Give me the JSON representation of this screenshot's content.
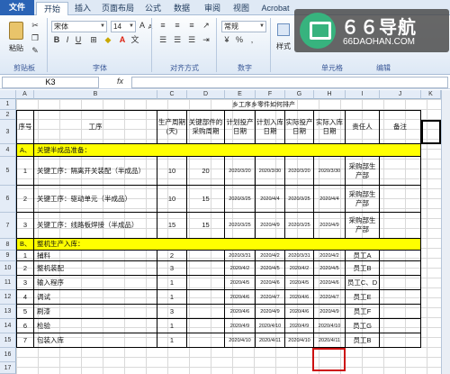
{
  "tabs": [
    "文件",
    "开始",
    "插入",
    "页面布局",
    "公式",
    "数据",
    "审阅",
    "视图",
    "Acrobat"
  ],
  "ribbon": {
    "paste_label": "粘贴",
    "font_name": "宋体",
    "font_size": "14",
    "number_format": "常规",
    "style_label": "样式",
    "groups": {
      "clipboard": "剪贴板",
      "font": "字体",
      "align": "对齐方式",
      "number": "数字",
      "cells": "单元格",
      "edit": "编辑"
    }
  },
  "watermark": {
    "title": "６６导航",
    "sub": "66DAOHAN.COM"
  },
  "formula_bar": {
    "name_box": "K3",
    "fx": "fx"
  },
  "columns": [
    "A",
    "B",
    "C",
    "D",
    "E",
    "F",
    "G",
    "H",
    "I",
    "J",
    "K"
  ],
  "sheet": {
    "title": "乡工序乡零件如何排产",
    "headers": [
      "序号",
      "工序",
      "生产周期(天)",
      "关键部件的采购周期",
      "计划投产日期",
      "计划入库日期",
      "实际投产日期",
      "实际入库日期",
      "责任人",
      "备注"
    ],
    "section_a": {
      "num": "A、",
      "label": "关键半成品准备："
    },
    "section_b": {
      "num": "B、",
      "label": "整机生产入库："
    },
    "group_a": [
      {
        "n": "1",
        "name": "关键工序：隔离开关装配（半成品）",
        "cycle": "10",
        "buy": "20",
        "p1": "2020/3/20",
        "p2": "2020/3/30",
        "a1": "2020/3/20",
        "a2": "2020/3/30",
        "owner": "采购部生产部"
      },
      {
        "n": "2",
        "name": "关键工序：驱动单元（半成品）",
        "cycle": "10",
        "buy": "15",
        "p1": "2020/3/25",
        "p2": "2020/4/4",
        "a1": "2020/3/25",
        "a2": "2020/4/4",
        "owner": "采购部生产部"
      },
      {
        "n": "3",
        "name": "关键工序：线路板焊接（半成品）",
        "cycle": "15",
        "buy": "15",
        "p1": "2020/3/25",
        "p2": "2020/4/9",
        "a1": "2020/3/25",
        "a2": "2020/4/9",
        "owner": "采购部生产部"
      }
    ],
    "group_b": [
      {
        "n": "1",
        "name": "捕料",
        "cycle": "2",
        "p1": "2020/3/31",
        "p2": "2020/4/2",
        "a1": "2020/3/31",
        "a2": "2020/4/2",
        "owner": "员工A"
      },
      {
        "n": "2",
        "name": "整机装配",
        "cycle": "3",
        "p1": "2020/4/2",
        "p2": "2020/4/5",
        "a1": "2020/4/2",
        "a2": "2020/4/5",
        "owner": "员工B"
      },
      {
        "n": "3",
        "name": "输入程序",
        "cycle": "1",
        "p1": "2020/4/5",
        "p2": "2020/4/6",
        "a1": "2020/4/5",
        "a2": "2020/4/6",
        "owner": "员工C、D"
      },
      {
        "n": "4",
        "name": "调试",
        "cycle": "1",
        "p1": "2020/4/6",
        "p2": "2020/4/7",
        "a1": "2020/4/6",
        "a2": "2020/4/7",
        "owner": "员工E"
      },
      {
        "n": "5",
        "name": "刷漆",
        "cycle": "3",
        "p1": "2020/4/6",
        "p2": "2020/4/9",
        "a1": "2020/4/6",
        "a2": "2020/4/9",
        "owner": "员工F"
      },
      {
        "n": "6",
        "name": "检验",
        "cycle": "1",
        "p1": "2020/4/9",
        "p2": "2020/4/10",
        "a1": "2020/4/9",
        "a2": "2020/4/10",
        "owner": "员工G"
      },
      {
        "n": "7",
        "name": "包装入库",
        "cycle": "1",
        "p1": "2020/4/10",
        "p2": "2020/4/11",
        "a1": "2020/4/10",
        "a2": "2020/4/11",
        "owner": "员工B"
      }
    ]
  }
}
